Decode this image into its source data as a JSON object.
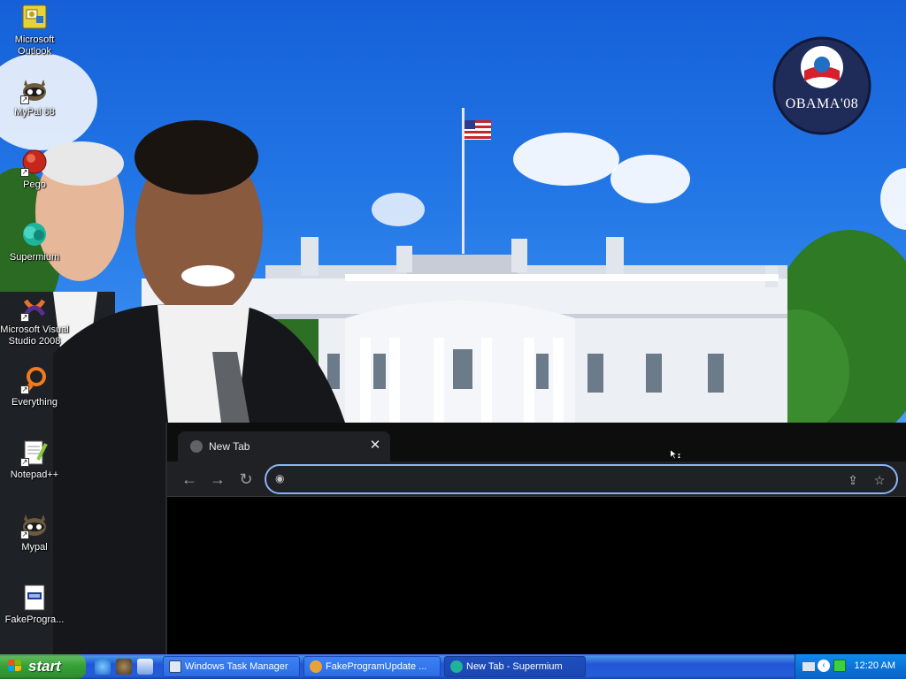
{
  "wallpaper": {
    "badge_text": "OBAMA'08"
  },
  "desktop_icons": [
    {
      "label": "Microsoft Outlook",
      "icon": "outlook-icon"
    },
    {
      "label": "MyPal 68",
      "icon": "mypal-icon"
    },
    {
      "label": "Pego",
      "icon": "pego-icon"
    },
    {
      "label": "Supermium",
      "icon": "supermium-icon"
    },
    {
      "label": "Microsoft Visual Studio 2008",
      "icon": "visual-studio-icon"
    },
    {
      "label": "Everything",
      "icon": "everything-icon"
    },
    {
      "label": "Notepad++",
      "icon": "notepadpp-icon"
    },
    {
      "label": "Mypal",
      "icon": "mypal-icon"
    },
    {
      "label": "FakeProgra...",
      "icon": "executable-icon"
    }
  ],
  "browser": {
    "tab_title": "New Tab",
    "address_value": "",
    "address_placeholder": ""
  },
  "taskbar": {
    "start_label": "start",
    "buttons": [
      {
        "label": "Windows Task Manager"
      },
      {
        "label": "FakeProgramUpdate ..."
      },
      {
        "label": "New Tab - Supermium"
      }
    ],
    "clock": "12:20 AM"
  },
  "colors": {
    "taskbar_blue": "#245dd7",
    "start_green": "#36a236",
    "omnibox_focus": "#8ab4f8",
    "browser_dark": "#202124"
  }
}
